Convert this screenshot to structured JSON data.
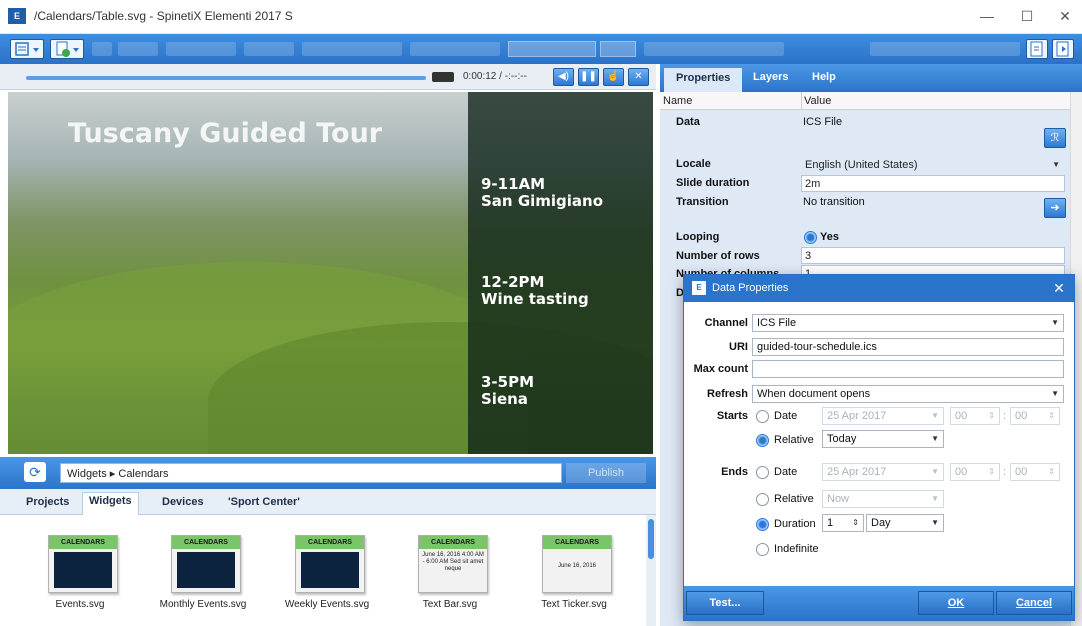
{
  "window": {
    "app_icon_text": "E",
    "title": "/Calendars/Table.svg - SpinetiX Elementi 2017 S",
    "minimize": "—",
    "maximize": "☐",
    "close": "✕"
  },
  "player": {
    "time": "0:00:12 / -:--:--",
    "progress": 0.0
  },
  "preview": {
    "title": "Tuscany Guided Tour",
    "schedule": [
      {
        "time": "9-11AM",
        "place": "San Gimigiano"
      },
      {
        "time": "12-2PM",
        "place": "Wine tasting"
      },
      {
        "time": "3-5PM",
        "place": "Siena"
      }
    ]
  },
  "nav": {
    "breadcrumb": "Widgets ▸ Calendars",
    "publish": "Publish"
  },
  "bottom_tabs": [
    "Projects",
    "Widgets",
    "Devices",
    "'Sport Center'"
  ],
  "bottom_active_tab": "Widgets",
  "widgets": [
    {
      "header": "CALENDARS",
      "label": "Events.svg",
      "preview": "dark",
      "text": ""
    },
    {
      "header": "CALENDARS",
      "label": "Monthly Events.svg",
      "preview": "dark",
      "text": ""
    },
    {
      "header": "CALENDARS",
      "label": "Weekly Events.svg",
      "preview": "dark",
      "text": ""
    },
    {
      "header": "CALENDARS",
      "label": "Text Bar.svg",
      "preview": "text",
      "text": "June 16, 2016 4:00 AM - 6:00 AM Sed sit amet neque"
    },
    {
      "header": "CALENDARS",
      "label": "Text Ticker.svg",
      "preview": "text",
      "text": "June 16, 2016"
    }
  ],
  "right_tabs": [
    "Properties",
    "Layers",
    "Help"
  ],
  "right_active_tab": "Properties",
  "props": {
    "col_name": "Name",
    "col_value": "Value",
    "data_name": "Data",
    "data_value": "ICS File",
    "locale_name": "Locale",
    "locale_value": "English (United States)",
    "slide_duration_name": "Slide duration",
    "slide_duration_value": "2m",
    "transition_name": "Transition",
    "transition_value": "No transition",
    "looping_name": "Looping",
    "looping_value": "Yes",
    "rows_name": "Number of rows",
    "rows_value": "3",
    "cols_name": "Number of columns",
    "cols_value": "1",
    "d_name": "D"
  },
  "dialog": {
    "title": "Data Properties",
    "icon_text": "E",
    "channel_label": "Channel",
    "channel_value": "ICS File",
    "uri_label": "URI",
    "uri_value": "guided-tour-schedule.ics",
    "max_count_label": "Max count",
    "max_count_value": "",
    "refresh_label": "Refresh",
    "refresh_value": "When document opens",
    "starts_label": "Starts",
    "starts_date_label": "Date",
    "starts_date_value": "25 Apr 2017",
    "starts_hour": "00",
    "starts_min": "00",
    "starts_relative_label": "Relative",
    "starts_relative_value": "Today",
    "ends_label": "Ends",
    "ends_date_label": "Date",
    "ends_date_value": "25 Apr 2017",
    "ends_hour": "00",
    "ends_min": "00",
    "ends_relative_label": "Relative",
    "ends_relative_value": "Now",
    "ends_duration_label": "Duration",
    "ends_duration_num": "1",
    "ends_duration_unit": "Day",
    "ends_indefinite_label": "Indefinite",
    "test_button": "Test...",
    "ok_button": "OK",
    "cancel_button": "Cancel"
  }
}
